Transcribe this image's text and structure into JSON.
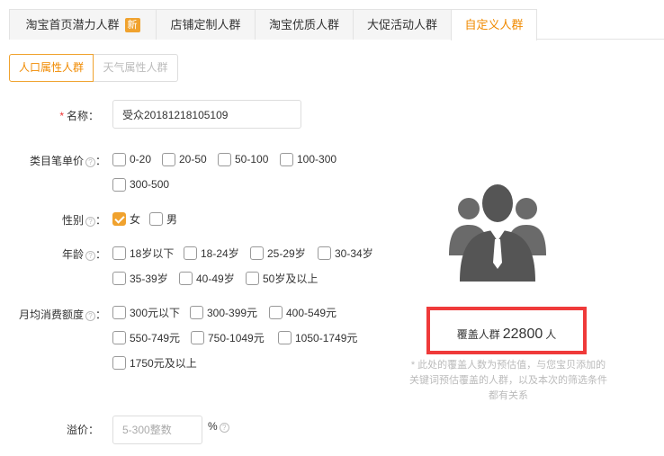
{
  "tabs": [
    {
      "label": "淘宝首页潜力人群",
      "badge": "新"
    },
    {
      "label": "店铺定制人群"
    },
    {
      "label": "淘宝优质人群"
    },
    {
      "label": "大促活动人群"
    },
    {
      "label": "自定义人群",
      "active": true
    }
  ],
  "subtabs": {
    "active": "人口属性人群",
    "inactive": "天气属性人群"
  },
  "form": {
    "name": {
      "required_mark": "*",
      "label": "名称：",
      "value": "受众20181218105109"
    },
    "category_price": {
      "label": "类目笔单价",
      "colon": "：",
      "options": [
        "0-20",
        "20-50",
        "50-100",
        "100-300",
        "300-500"
      ]
    },
    "gender": {
      "label": "性别",
      "colon": "：",
      "options": [
        "女",
        "男"
      ],
      "checked": [
        "女"
      ]
    },
    "age": {
      "label": "年龄",
      "colon": "：",
      "options": [
        "18岁以下",
        "18-24岁",
        "25-29岁",
        "30-34岁",
        "35-39岁",
        "40-49岁",
        "50岁及以上"
      ]
    },
    "monthly_spend": {
      "label": "月均消费额度",
      "colon": "：",
      "options": [
        "300元以下",
        "300-399元",
        "400-549元",
        "550-749元",
        "750-1049元",
        "1050-1749元",
        "1750元及以上"
      ]
    },
    "premium": {
      "label": "溢价：",
      "placeholder": "5-300整数",
      "unit": "%"
    }
  },
  "help_glyph": "?",
  "coverage": {
    "label": "覆盖人群",
    "value": "22800",
    "unit": "人",
    "highlight_color": "#ef3a3a"
  },
  "note": {
    "lines": [
      "* 此处的覆盖人数为预估值，与您宝贝添加的",
      "关键词预估覆盖的人群，以及本次的筛选条件",
      "都有关系"
    ]
  },
  "colors": {
    "accent": "#f08a00",
    "badge": "#f0a22e",
    "icon": "#555555"
  }
}
